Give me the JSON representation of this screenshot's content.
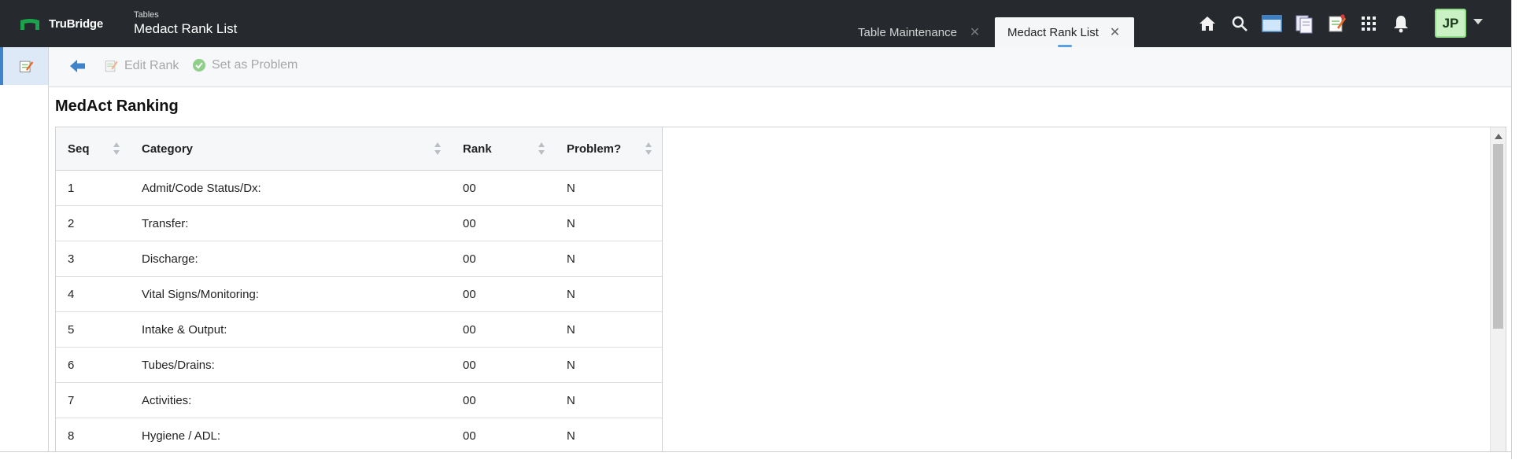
{
  "brand": {
    "name": "TruBridge"
  },
  "header": {
    "subtitle": "Tables",
    "title": "Medact Rank List"
  },
  "tabs": [
    {
      "label": "Table Maintenance",
      "active": false
    },
    {
      "label": "Medact Rank List",
      "active": true
    }
  ],
  "top_icons": [
    "home-icon",
    "search-icon",
    "window-icon",
    "documents-icon",
    "notepad-icon",
    "apps-grid-icon",
    "bell-icon"
  ],
  "user": {
    "initials": "JP"
  },
  "toolbar": {
    "edit_label": "Edit Rank",
    "problem_label": "Set as Problem"
  },
  "page": {
    "title": "MedAct Ranking"
  },
  "table": {
    "columns": [
      "Seq",
      "Category",
      "Rank",
      "Problem?"
    ],
    "rows": [
      {
        "seq": "1",
        "category": "Admit/Code Status/Dx:",
        "rank": "00",
        "problem": "N"
      },
      {
        "seq": "2",
        "category": "Transfer:",
        "rank": "00",
        "problem": "N"
      },
      {
        "seq": "3",
        "category": "Discharge:",
        "rank": "00",
        "problem": "N"
      },
      {
        "seq": "4",
        "category": "Vital Signs/Monitoring:",
        "rank": "00",
        "problem": "N"
      },
      {
        "seq": "5",
        "category": "Intake & Output:",
        "rank": "00",
        "problem": "N"
      },
      {
        "seq": "6",
        "category": "Tubes/Drains:",
        "rank": "00",
        "problem": "N"
      },
      {
        "seq": "7",
        "category": "Activities:",
        "rank": "00",
        "problem": "N"
      },
      {
        "seq": "8",
        "category": "Hygiene / ADL:",
        "rank": "00",
        "problem": "N"
      }
    ]
  },
  "colors": {
    "topbar": "#262a2e",
    "accent": "#3f83c9",
    "brand_green": "#1aa34a",
    "avatar_bg": "#c9f1c3"
  }
}
